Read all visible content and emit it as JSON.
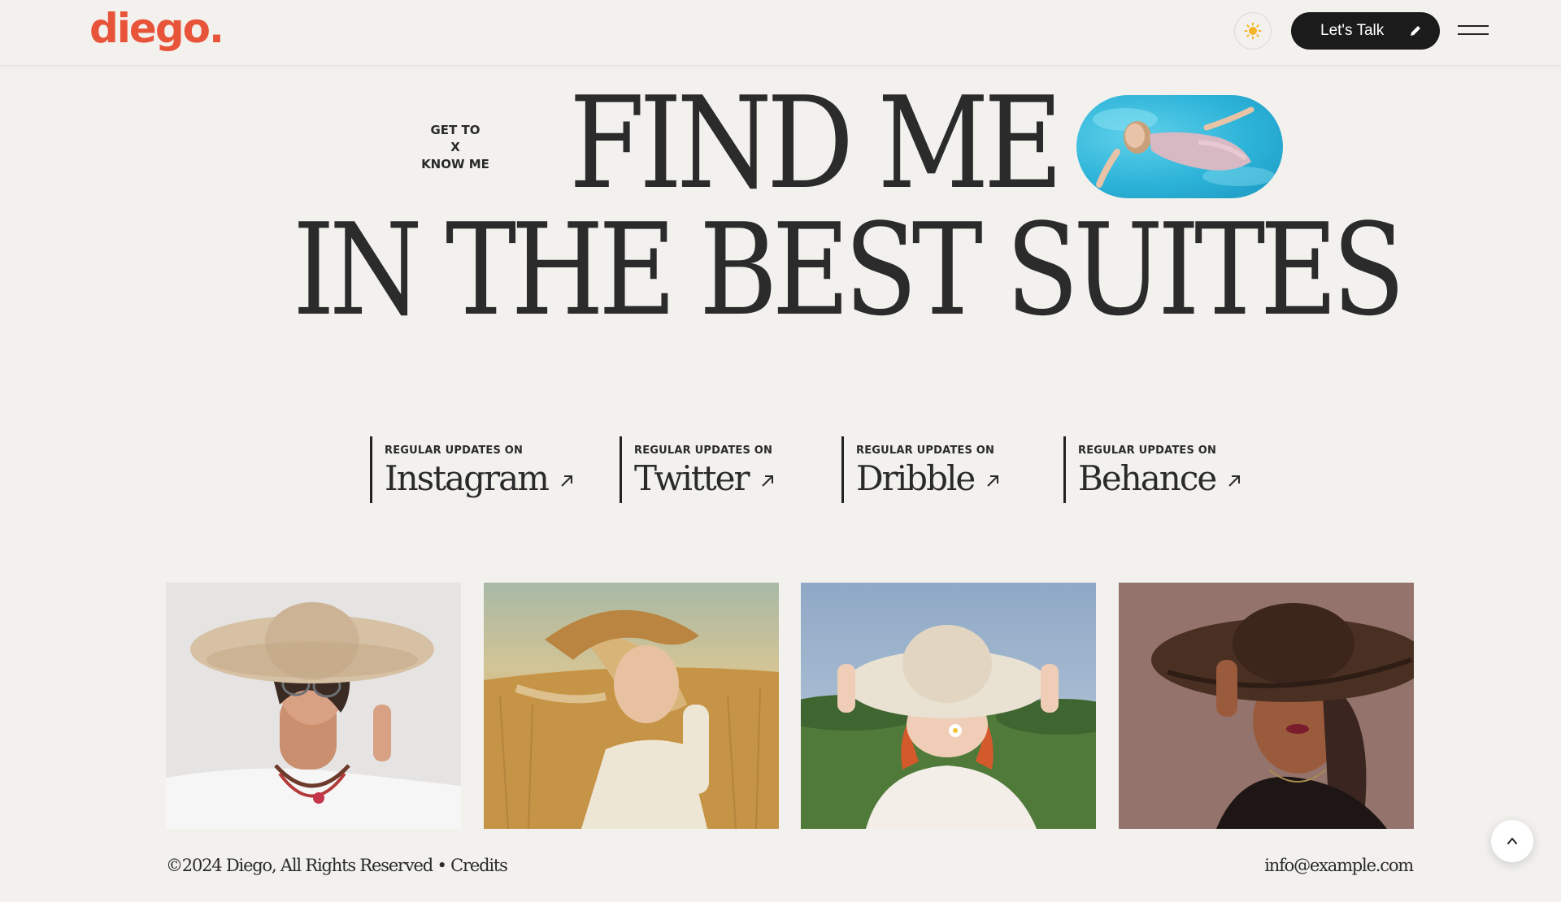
{
  "header": {
    "logo": "diego.",
    "lets_talk_label": "Let's Talk"
  },
  "icons": {
    "theme": "sun-icon",
    "talk": "pencil-icon",
    "menu": "hamburger-menu-icon",
    "social_arrow": "arrow-up-right-icon",
    "scroll_top": "chevron-up-icon"
  },
  "hero": {
    "get_to_lines": [
      "GET TO",
      "X",
      "KNOW ME"
    ],
    "line1": "FIND ME",
    "line2": "IN THE BEST SUITES"
  },
  "social": [
    {
      "caption": "REGULAR UPDATES ON",
      "name": "Instagram"
    },
    {
      "caption": "REGULAR UPDATES ON",
      "name": "Twitter"
    },
    {
      "caption": "REGULAR UPDATES ON",
      "name": "Dribble"
    },
    {
      "caption": "REGULAR UPDATES ON",
      "name": "Behance"
    }
  ],
  "footer": {
    "copyright": "©2024 Diego, All Rights Reserved • Credits",
    "email": "info@example.com"
  },
  "colors": {
    "brand": "#e8543a",
    "background": "#f2f1ee",
    "button_dark": "#1b1b1b",
    "sun": "#f5b52a"
  }
}
